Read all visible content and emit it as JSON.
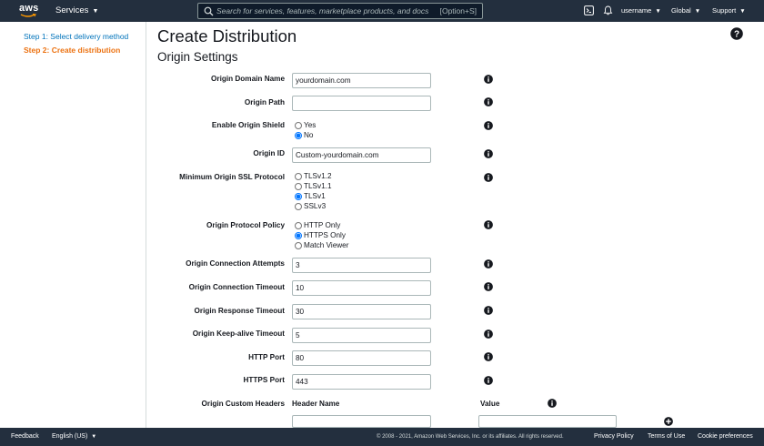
{
  "topnav": {
    "logo": "aws",
    "services_label": "Services",
    "search_placeholder": "Search for services, features, marketplace products, and docs",
    "search_shortcut": "[Option+S]",
    "username": "username",
    "region": "Global",
    "support": "Support"
  },
  "sidebar": {
    "step1": "Step 1: Select delivery method",
    "step2": "Step 2: Create distribution"
  },
  "main": {
    "title": "Create Distribution",
    "section": "Origin Settings",
    "fields": {
      "origin_domain_name": {
        "label": "Origin Domain Name",
        "value": "yourdomain.com"
      },
      "origin_path": {
        "label": "Origin Path",
        "value": ""
      },
      "enable_origin_shield": {
        "label": "Enable Origin Shield",
        "options": [
          "Yes",
          "No"
        ],
        "selected": "No"
      },
      "origin_id": {
        "label": "Origin ID",
        "value": "Custom-yourdomain.com"
      },
      "min_ssl_protocol": {
        "label": "Minimum Origin SSL Protocol",
        "options": [
          "TLSv1.2",
          "TLSv1.1",
          "TLSv1",
          "SSLv3"
        ],
        "selected": "TLSv1"
      },
      "origin_protocol_policy": {
        "label": "Origin Protocol Policy",
        "options": [
          "HTTP Only",
          "HTTPS Only",
          "Match Viewer"
        ],
        "selected": "HTTPS Only"
      },
      "connection_attempts": {
        "label": "Origin Connection Attempts",
        "value": "3"
      },
      "connection_timeout": {
        "label": "Origin Connection Timeout",
        "value": "10"
      },
      "response_timeout": {
        "label": "Origin Response Timeout",
        "value": "30"
      },
      "keepalive_timeout": {
        "label": "Origin Keep-alive Timeout",
        "value": "5"
      },
      "http_port": {
        "label": "HTTP Port",
        "value": "80"
      },
      "https_port": {
        "label": "HTTPS Port",
        "value": "443"
      },
      "custom_headers": {
        "label": "Origin Custom Headers",
        "header_name_col": "Header Name",
        "value_col": "Value",
        "header_name": "",
        "header_value": ""
      }
    }
  },
  "footer": {
    "feedback": "Feedback",
    "language": "English (US)",
    "copyright": "© 2008 - 2021, Amazon Web Services, Inc. or its affiliates. All rights reserved.",
    "privacy": "Privacy Policy",
    "terms": "Terms of Use",
    "cookies": "Cookie preferences"
  },
  "colors": {
    "nav_bg": "#232f3e",
    "link": "#0073bb",
    "active_step": "#ec7211"
  }
}
